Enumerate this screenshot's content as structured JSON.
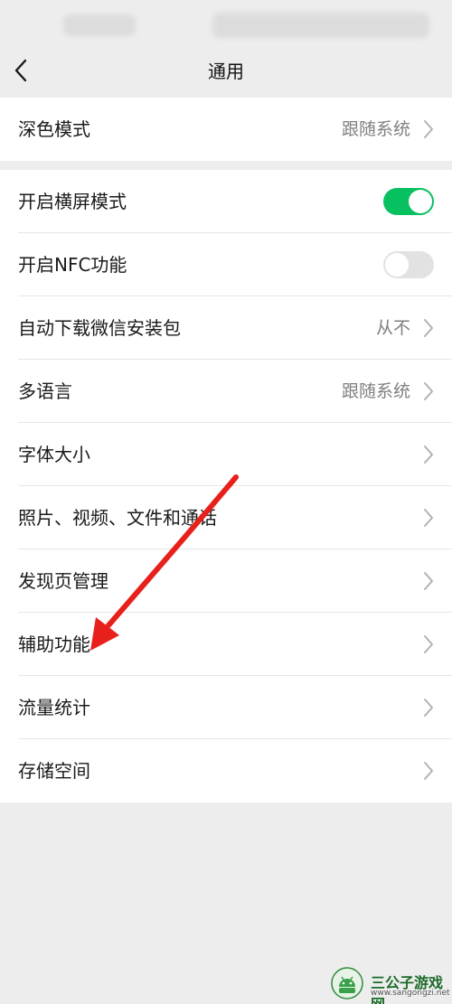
{
  "header": {
    "title": "通用"
  },
  "rows": {
    "dark_mode": {
      "label": "深色模式",
      "value": "跟随系统"
    },
    "landscape": {
      "label": "开启横屏模式",
      "enabled": true
    },
    "nfc": {
      "label": "开启NFC功能",
      "enabled": false
    },
    "auto_download": {
      "label": "自动下载微信安装包",
      "value": "从不"
    },
    "language": {
      "label": "多语言",
      "value": "跟随系统"
    },
    "font_size": {
      "label": "字体大小"
    },
    "media": {
      "label": "照片、视频、文件和通话"
    },
    "discover": {
      "label": "发现页管理"
    },
    "accessibility": {
      "label": "辅助功能"
    },
    "traffic": {
      "label": "流量统计"
    },
    "storage": {
      "label": "存储空间"
    }
  },
  "colors": {
    "switch_on": "#07c160",
    "annotation_arrow": "#e8201c"
  },
  "watermark": {
    "title": "三公子游戏网",
    "url": "www.sangongzi.net"
  }
}
